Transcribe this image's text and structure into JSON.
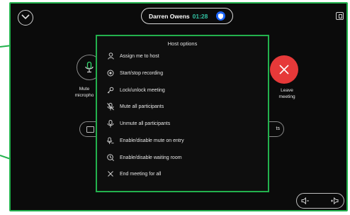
{
  "header": {
    "participant_name": "Darren Owens",
    "call_time": "01:28"
  },
  "controls": {
    "mute_label": "Mute\nmicropho",
    "leave_label": "Leave\nmeeting",
    "right_pill_text": "ts"
  },
  "host_menu": {
    "title": "Host options",
    "items": [
      {
        "label": "Assign me to host",
        "icon": "person-icon"
      },
      {
        "label": "Start/stop recording",
        "icon": "record-icon"
      },
      {
        "label": "Lock/unlock meeting",
        "icon": "key-icon"
      },
      {
        "label": "Mute all participants",
        "icon": "mic-off-icon"
      },
      {
        "label": "Unmute all participants",
        "icon": "mic-icon"
      },
      {
        "label": "Enable/disable mute on entry",
        "icon": "mic-entry-icon"
      },
      {
        "label": "Enable/disable waiting room",
        "icon": "waiting-room-icon"
      },
      {
        "label": "End meeting for all",
        "icon": "close-icon"
      }
    ]
  },
  "colors": {
    "accent_green": "#23b14d",
    "leave_red": "#e63939",
    "timer_teal": "#32c3a4",
    "shield_blue": "#1d67ff"
  }
}
